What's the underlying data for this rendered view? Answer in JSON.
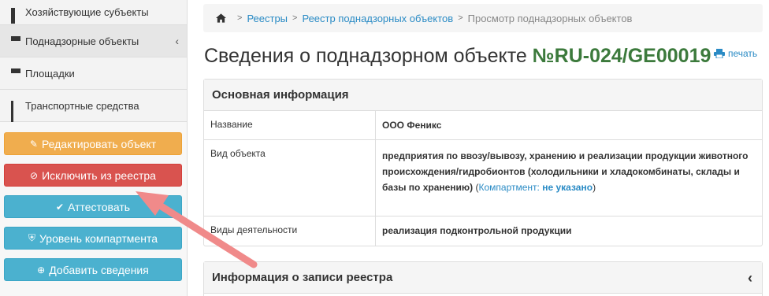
{
  "sidebar": {
    "items": [
      {
        "label": "Хозяйствующие субъекты"
      },
      {
        "label": "Поднадзорные объекты"
      },
      {
        "label": "Площадки"
      },
      {
        "label": "Транспортные средства"
      }
    ],
    "buttons": {
      "edit": "Редактировать объект",
      "exclude": "Исключить из реестра",
      "attest": "Аттестовать",
      "compartment": "Уровень компартмента",
      "add": "Добавить сведения"
    }
  },
  "breadcrumb": {
    "items": [
      "Реестры",
      "Реестр поднадзорных объектов"
    ],
    "current": "Просмотр поднадзорных объектов"
  },
  "header": {
    "title": "Сведения о поднадзорном объекте",
    "number": "№RU-024/GE00019",
    "print": "печать"
  },
  "main_info": {
    "heading": "Основная информация",
    "rows": [
      {
        "key": "Название",
        "value": "ООО Феникс"
      },
      {
        "key": "Вид объекта",
        "value": "предприятия по ввозу/вывозу, хранению и реализации продукции животного происхождения/гидробионтов (холодильники и хладокомбинаты, склады и базы по хранению)",
        "compartment_label": "Компартмент:",
        "compartment_value": "не указано"
      },
      {
        "key": "Виды деятельности",
        "value": "реализация подконтрольной продукции"
      }
    ]
  },
  "registry_info": {
    "heading": "Информация о записи реестра"
  },
  "colors": {
    "accent_link": "#2a8bc5",
    "number_green": "#3c7a3c",
    "orange": "#f0ad4e",
    "red": "#d9534f",
    "blue": "#4bb1cf",
    "arrow": "#f08080"
  }
}
